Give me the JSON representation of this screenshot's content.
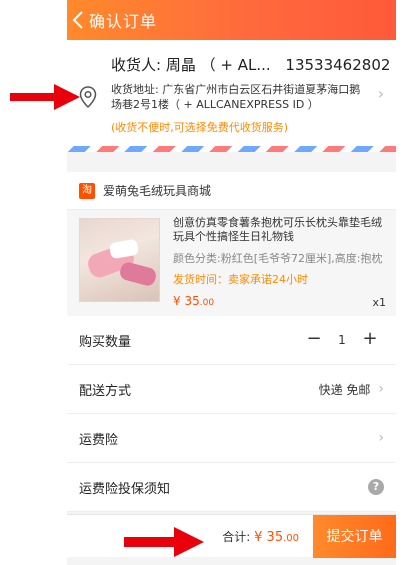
{
  "header": {
    "title": "确认订单"
  },
  "address": {
    "recipient_label": "收货人:",
    "recipient_name": "周晶 （ + AL...",
    "phone": "13533462802",
    "full_address": "收货地址: 广东省广州市白云区石井街道夏茅海口鹅场巷2号1楼（ + ALLCANEXPRESS ID ）",
    "note": "(收货不便时,可选择免费代收货服务)"
  },
  "shop": {
    "logo_text": "淘",
    "name": "爱萌兔毛绒玩具商城"
  },
  "item": {
    "title": "创意仿真零食薯条抱枕可乐长枕头靠垫毛绒玩具个性搞怪生日礼物钱",
    "spec": "颜色分类:粉红色[毛爷爷72厘米],高度:抱枕",
    "ship_time": "发货时间：卖家承诺24小时",
    "price_symbol": "¥",
    "price_int": "35",
    "price_dec": ".00",
    "qty": "x1"
  },
  "rows": {
    "quantity": {
      "label": "购买数量",
      "value": "1",
      "minus": "−",
      "plus": "+"
    },
    "delivery": {
      "label": "配送方式",
      "value": "快递 免邮"
    },
    "shipping_insurance": {
      "label": "运费险"
    },
    "insurance_notice": {
      "label": "运费险投保须知",
      "help": "?"
    }
  },
  "bottom": {
    "total_label": "合计:",
    "total_symbol": "¥",
    "total_int": "35",
    "total_dec": ".00",
    "submit_label": "提交订单"
  },
  "colors": {
    "accent": "#ff6a1a",
    "price": "#ff5000",
    "annotation": "#e8000b"
  }
}
